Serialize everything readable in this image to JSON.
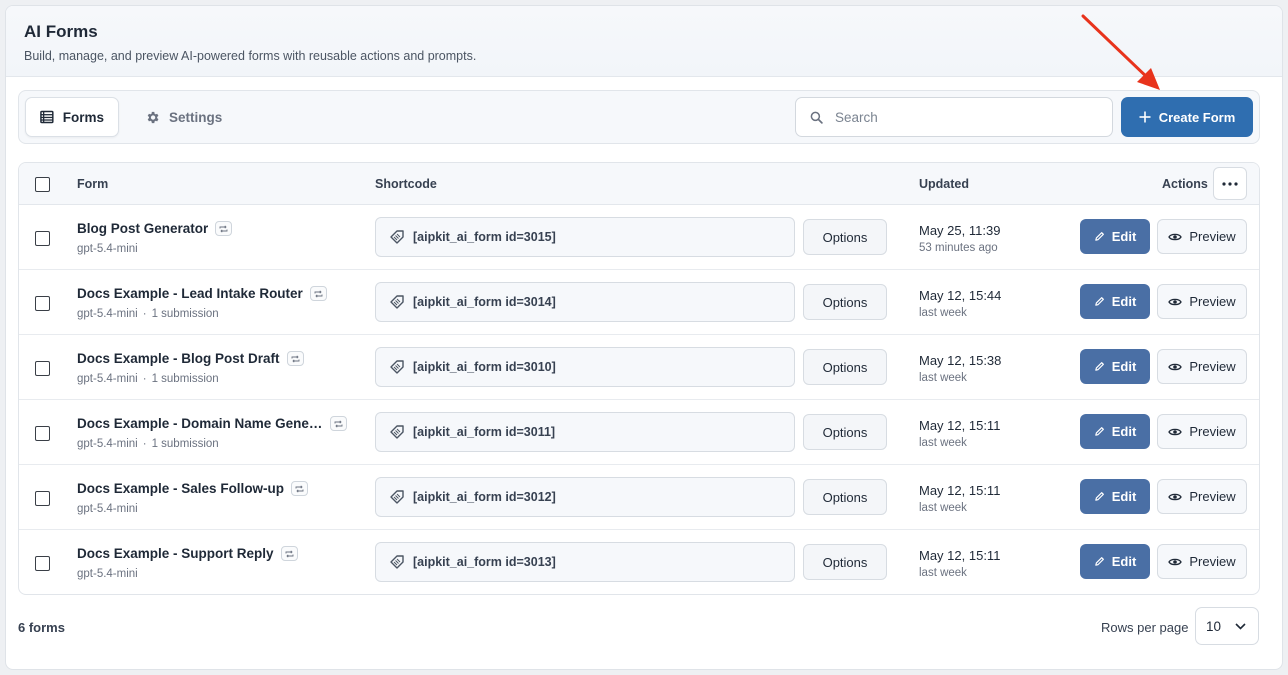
{
  "header": {
    "title": "AI Forms",
    "subtitle": "Build, manage, and preview AI-powered forms with reusable actions and prompts."
  },
  "toolbar": {
    "tabs": [
      {
        "label": "Forms",
        "icon": "table-list-icon",
        "active": true
      },
      {
        "label": "Settings",
        "icon": "gear-icon",
        "active": false
      }
    ],
    "search_placeholder": "Search",
    "search_value": "",
    "create_label": "Create Form"
  },
  "table": {
    "columns": {
      "form": "Form",
      "shortcode": "Shortcode",
      "updated": "Updated",
      "actions": "Actions"
    },
    "options_label": "Options",
    "edit_label": "Edit",
    "preview_label": "Preview",
    "rows": [
      {
        "name": "Blog Post Generator",
        "model": "gpt-5.4-mini",
        "submissions": "",
        "shortcode": "[aipkit_ai_form id=3015]",
        "updated": "May 25, 11:39",
        "updated_rel": "53 minutes ago"
      },
      {
        "name": "Docs Example - Lead Intake Router",
        "model": "gpt-5.4-mini",
        "submissions": "1 submission",
        "shortcode": "[aipkit_ai_form id=3014]",
        "updated": "May 12, 15:44",
        "updated_rel": "last week"
      },
      {
        "name": "Docs Example - Blog Post Draft",
        "model": "gpt-5.4-mini",
        "submissions": "1 submission",
        "shortcode": "[aipkit_ai_form id=3010]",
        "updated": "May 12, 15:38",
        "updated_rel": "last week"
      },
      {
        "name": "Docs Example - Domain Name Gener...",
        "model": "gpt-5.4-mini",
        "submissions": "1 submission",
        "shortcode": "[aipkit_ai_form id=3011]",
        "updated": "May 12, 15:11",
        "updated_rel": "last week"
      },
      {
        "name": "Docs Example - Sales Follow-up",
        "model": "gpt-5.4-mini",
        "submissions": "",
        "shortcode": "[aipkit_ai_form id=3012]",
        "updated": "May 12, 15:11",
        "updated_rel": "last week"
      },
      {
        "name": "Docs Example - Support Reply",
        "model": "gpt-5.4-mini",
        "submissions": "",
        "shortcode": "[aipkit_ai_form id=3013]",
        "updated": "May 12, 15:11",
        "updated_rel": "last week"
      }
    ]
  },
  "footer": {
    "count": "6 forms",
    "rows_per_page_label": "Rows per page",
    "rows_per_page_value": "10"
  },
  "colors": {
    "primary": "#2f6eb0",
    "edit": "#4a6fa5",
    "annotation_arrow": "#e8331c"
  }
}
